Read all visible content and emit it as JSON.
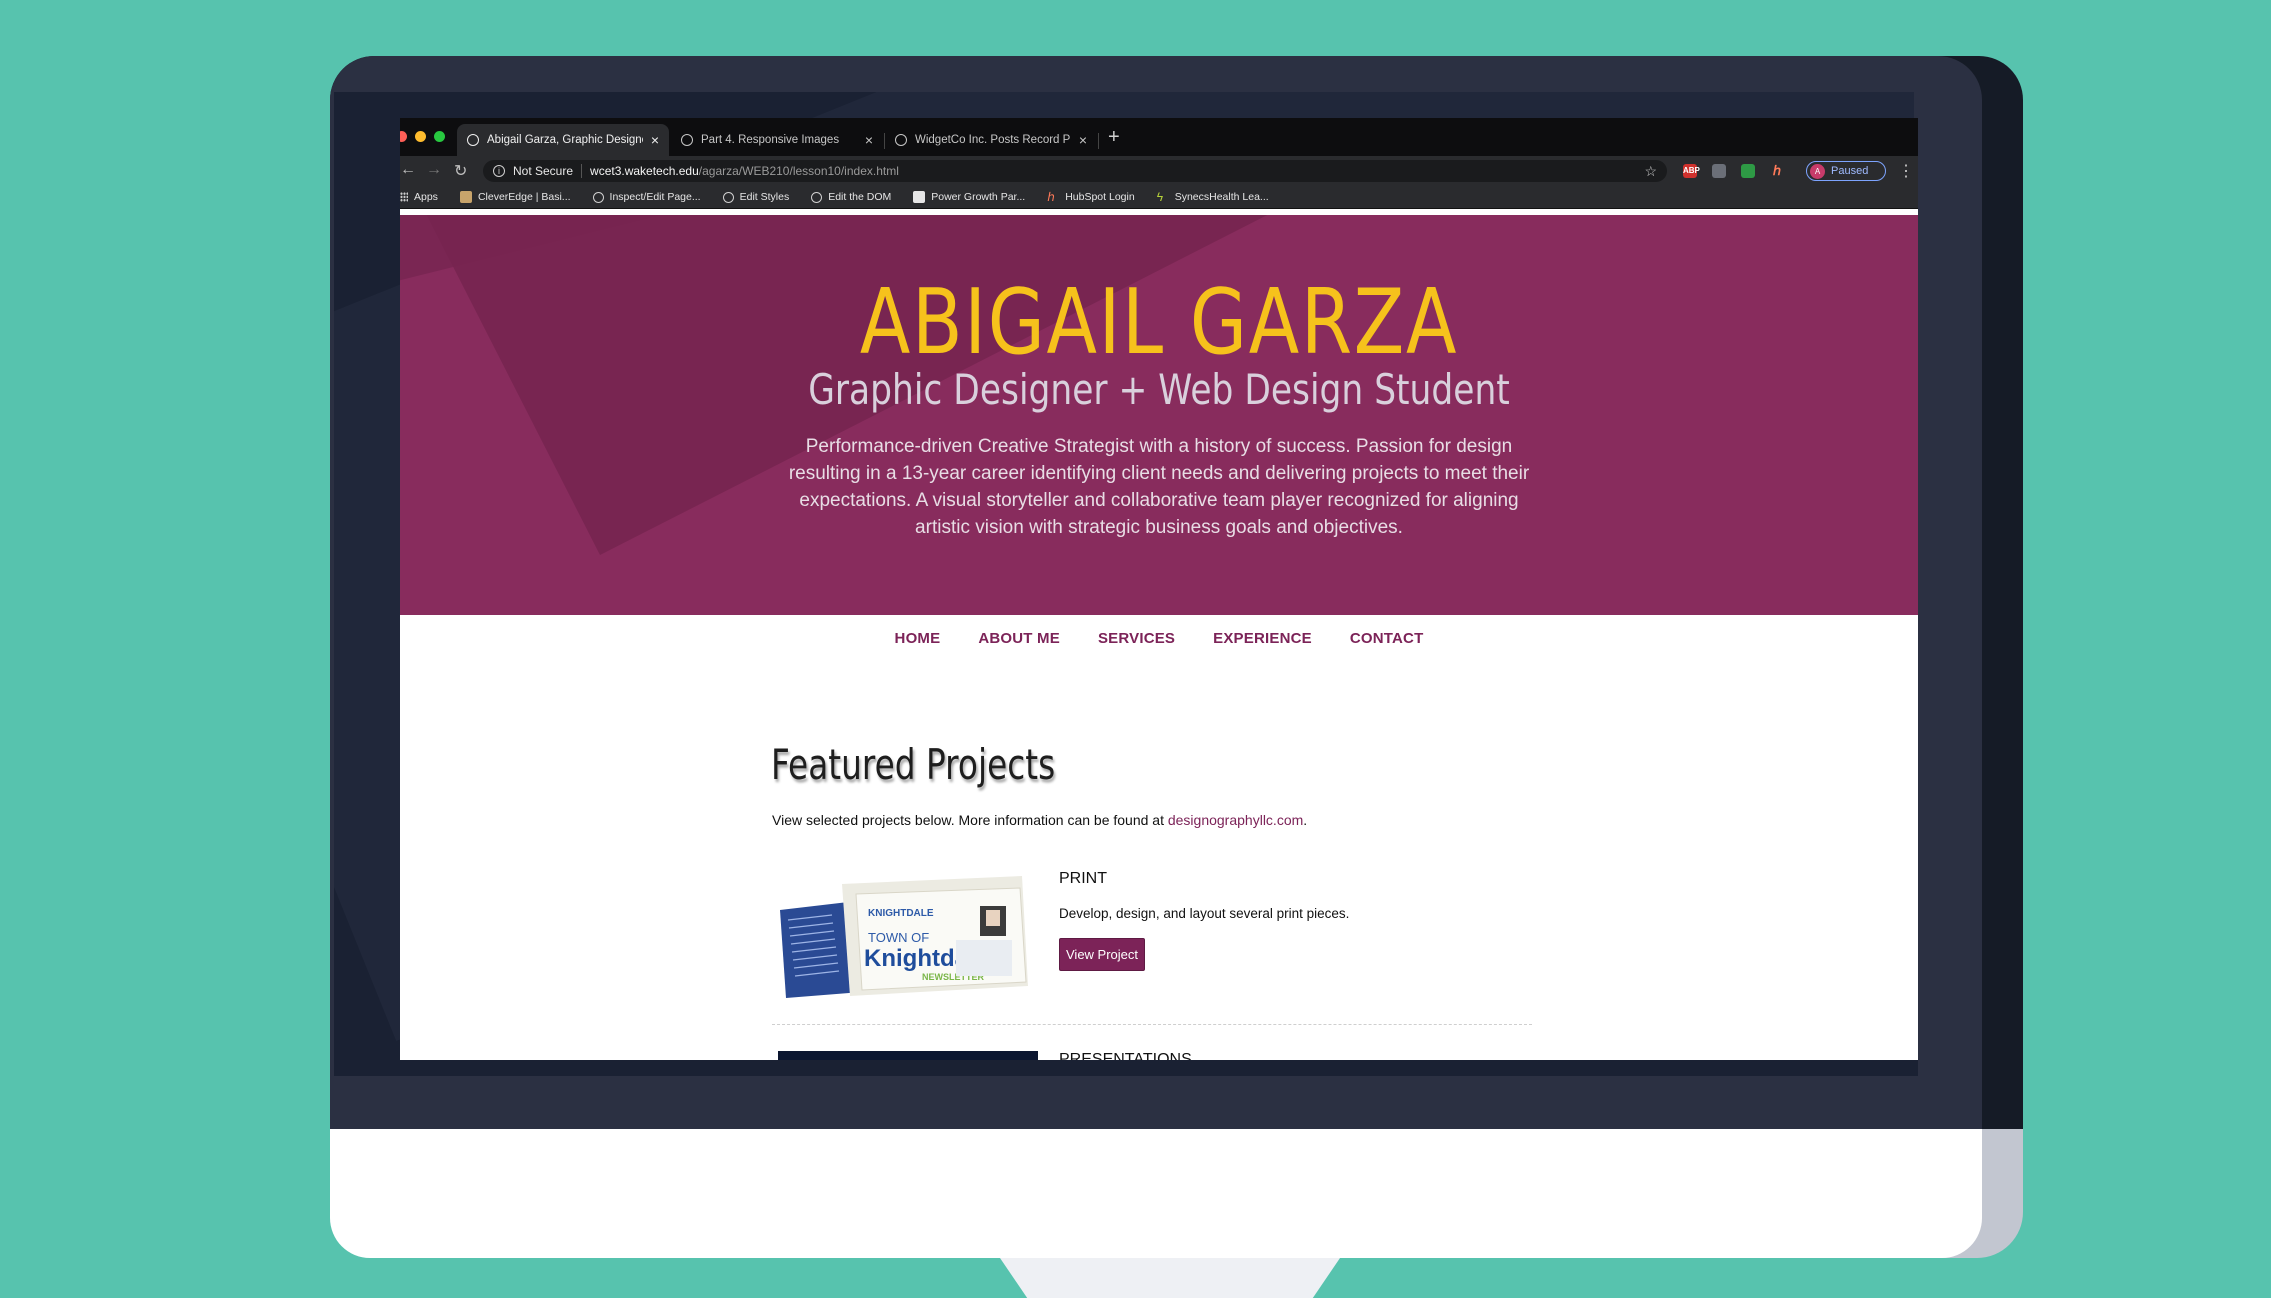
{
  "browser": {
    "tabs": [
      {
        "label": "Abigail Garza, Graphic Designer",
        "active": true
      },
      {
        "label": "Part 4. Responsive Images",
        "active": false
      },
      {
        "label": "WidgetCo Inc. Posts Record Pr",
        "active": false
      }
    ],
    "new_tab": "+",
    "address": {
      "security": "Not Secure",
      "host": "wcet3.waketech.edu",
      "path": "/agarza/WEB210/lesson10/index.html"
    },
    "profile": {
      "initial": "A",
      "status": "Paused"
    },
    "bookmarks": [
      "Apps",
      "CleverEdge | Basi...",
      "Inspect/Edit Page...",
      "Edit Styles",
      "Edit the DOM",
      "Power Growth Par...",
      "HubSpot Login",
      "SynecsHealth Lea..."
    ],
    "extensions": [
      "ABP",
      "ext-2",
      "ext-3",
      "HubSpot"
    ]
  },
  "hero": {
    "name": "ABIGAIL GARZA",
    "tagline": "Graphic Designer + Web Design Student",
    "description": "Performance-driven Creative Strategist with a history of success. Passion for design resulting in a 13-year career identifying client needs and delivering projects to meet their expectations. A visual storyteller and collaborative team player recognized for aligning artistic vision with strategic business goals and objectives."
  },
  "nav": [
    "HOME",
    "ABOUT ME",
    "SERVICES",
    "EXPERIENCE",
    "CONTACT"
  ],
  "featured": {
    "title": "Featured Projects",
    "intro_prefix": "View selected projects below. More information can be found at ",
    "intro_link": "designographyllc.com",
    "intro_suffix": ".",
    "projects": [
      {
        "title": "PRINT",
        "description": "Develop, design, and layout several print pieces.",
        "button": "View Project",
        "image_text": [
          "KNIGHTDALE",
          "TOWN OF",
          "Knightdale",
          "NEWSLETTER"
        ]
      },
      {
        "title": "PRESENTATIONS"
      }
    ]
  },
  "colors": {
    "background": "#57c3ae",
    "hero": "#882c5d",
    "accent_yellow": "#f6c21c",
    "brand_plum": "#7c2358"
  }
}
